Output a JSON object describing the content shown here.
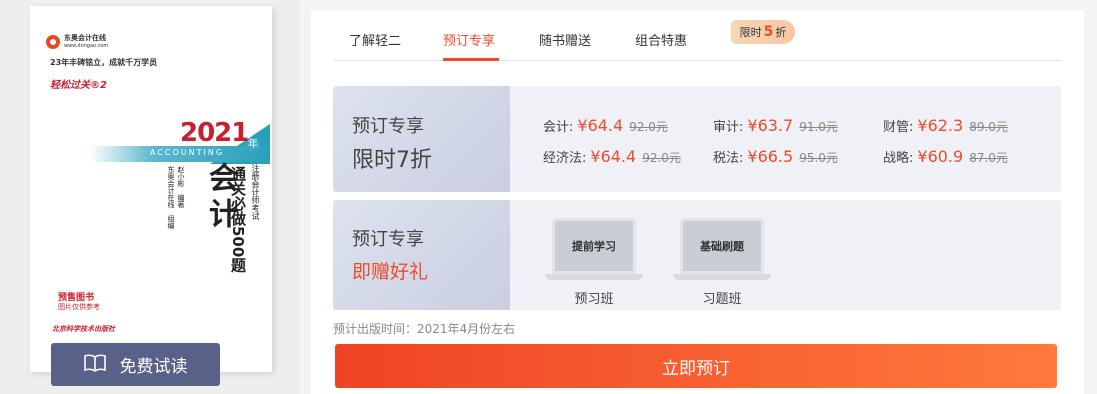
{
  "book": {
    "brand": "东奥会计在线",
    "brand_url": "www.dongao.com",
    "slogan": "23年丰碑铭立，成就千万学员",
    "series": "轻松过关®2",
    "year": "2021",
    "year_suffix": "年",
    "accounting_en": "ACCOUNTING",
    "exam": "注册会计师考试",
    "subtitle": "通关必做500题",
    "title": "会计",
    "author": "赵小彬　编著",
    "editor": "东奥会计在线　组编",
    "presale": "预售图书",
    "presale_note": "图片仅供参考",
    "publisher": "北京科学技术出版社"
  },
  "trial_button": {
    "label": "免费试读",
    "icon": "book-open-icon"
  },
  "tabs": [
    {
      "label": "了解轻二"
    },
    {
      "label": "预订专享"
    },
    {
      "label": "随书赠送"
    },
    {
      "label": "组合特惠"
    }
  ],
  "active_tab": "预订专享",
  "discount_badge": {
    "prefix": "限时",
    "value": "5",
    "suffix": "折"
  },
  "card1": {
    "title": "预订专享",
    "subtitle": "限时7折",
    "prices": [
      {
        "name": "会计:",
        "price": "¥64.4",
        "original": "92.0元"
      },
      {
        "name": "审计:",
        "price": "¥63.7",
        "original": "91.0元"
      },
      {
        "name": "财管:",
        "price": "¥62.3",
        "original": "89.0元"
      },
      {
        "name": "经济法:",
        "price": "¥64.4",
        "original": "92.0元"
      },
      {
        "name": "税法:",
        "price": "¥66.5",
        "original": "95.0元"
      },
      {
        "name": "战略:",
        "price": "¥60.9",
        "original": "87.0元"
      }
    ]
  },
  "card2": {
    "title": "预订专享",
    "subtitle": "即赠好礼",
    "gifts": [
      {
        "screen": "提前学习",
        "label": "预习班"
      },
      {
        "screen": "基础刷题",
        "label": "习题班"
      }
    ]
  },
  "publish_time": "预计出版时间：2021年4月份左右",
  "order_button": "立即预订",
  "colors": {
    "accent": "#ef4a2e",
    "trial_button": "#5a6188"
  }
}
